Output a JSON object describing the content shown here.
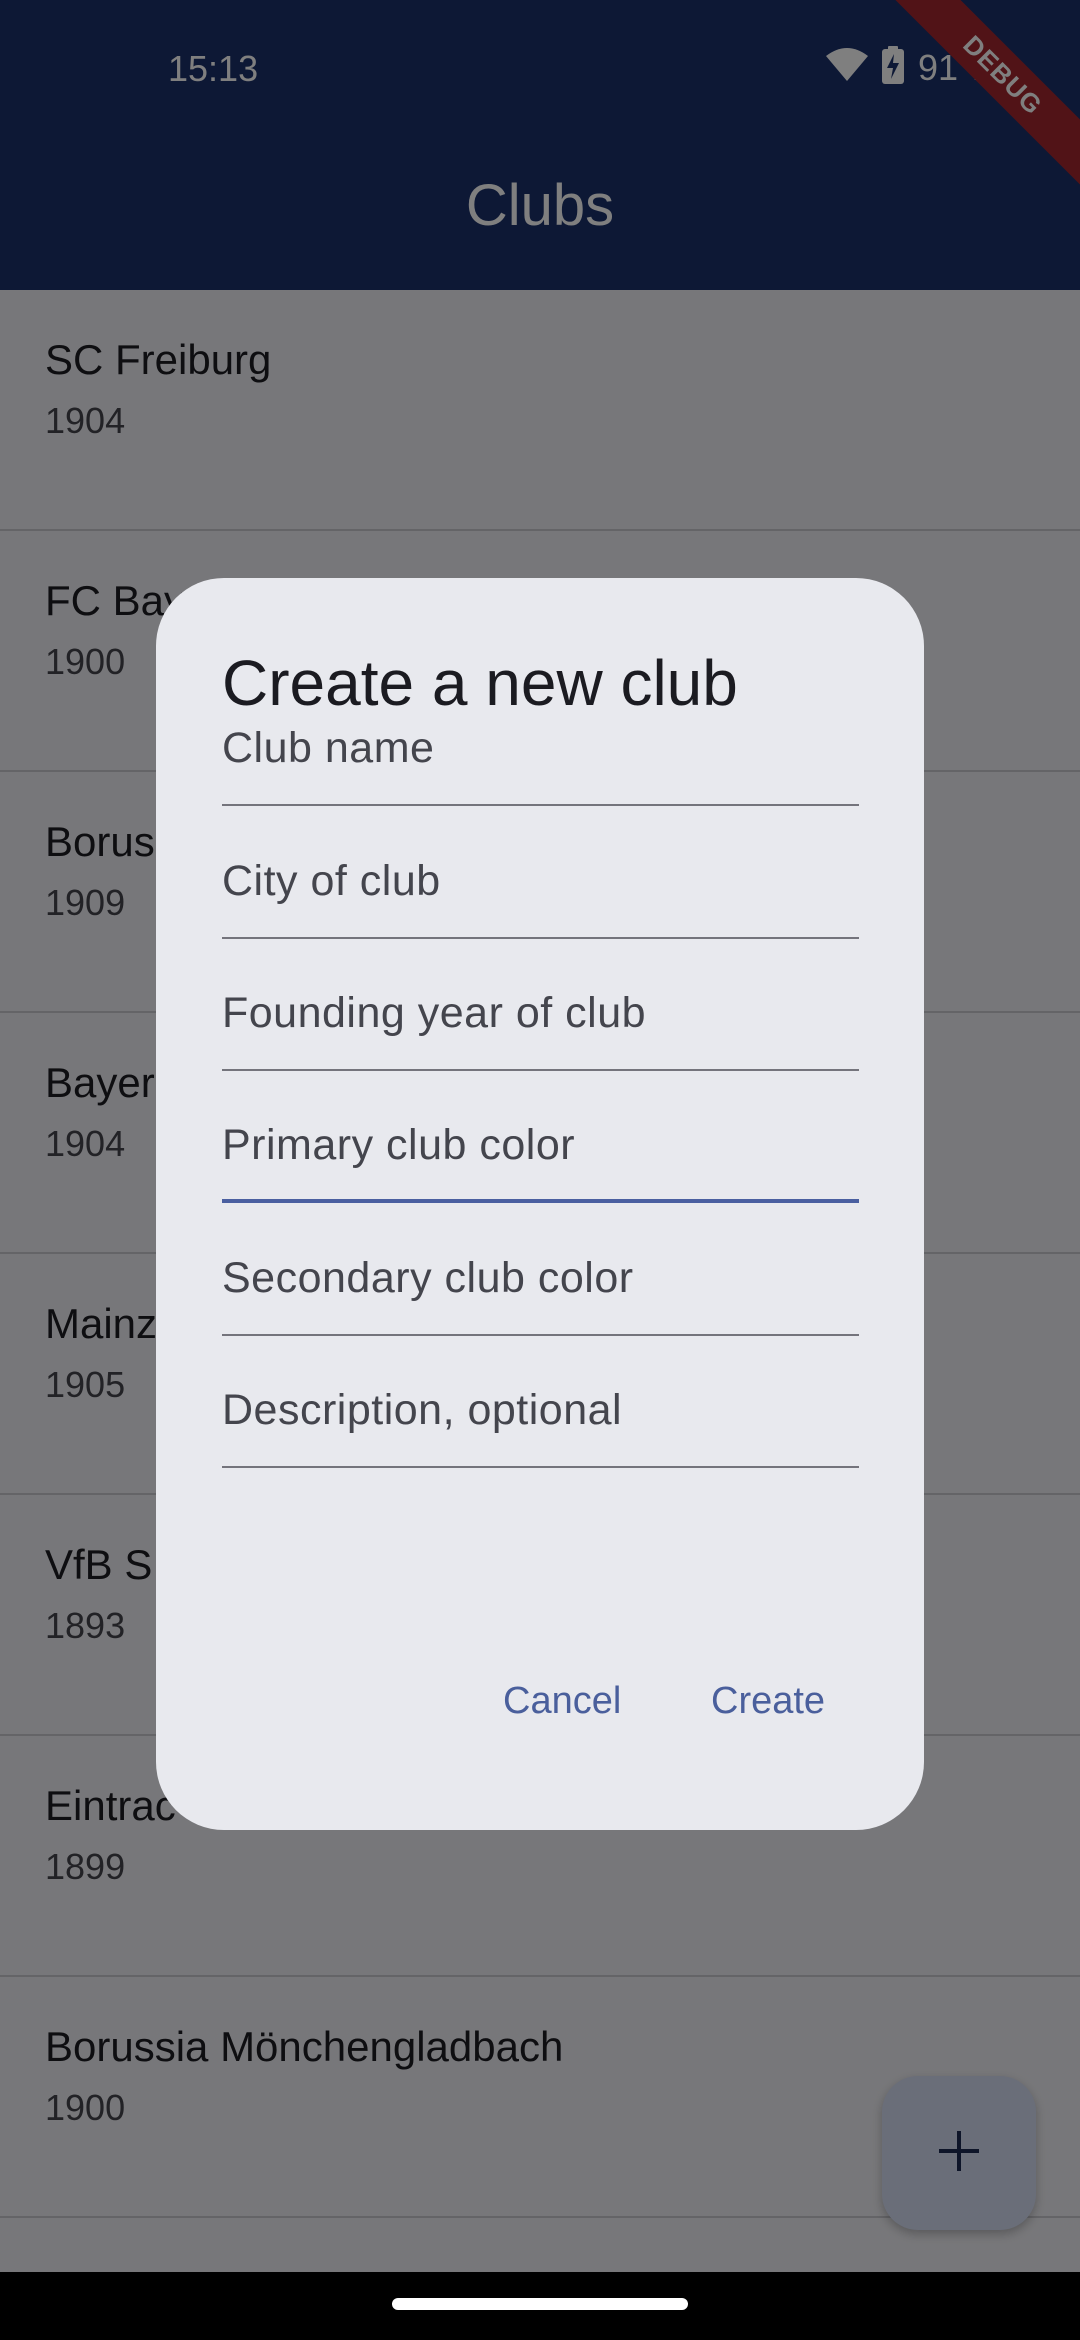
{
  "status_bar": {
    "time": "15:13",
    "battery": "91 %",
    "icons": [
      "wifi-icon",
      "battery-charging-icon"
    ]
  },
  "debug_banner": "DEBUG",
  "app_bar": {
    "title": "Clubs"
  },
  "clubs": [
    {
      "name": "SC Freiburg",
      "year": "1904"
    },
    {
      "name": "FC Bay",
      "year": "1900"
    },
    {
      "name": "Borus",
      "year": "1909"
    },
    {
      "name": "Bayer",
      "year": "1904"
    },
    {
      "name": "Mainz",
      "year": "1905"
    },
    {
      "name": "VfB S",
      "year": "1893"
    },
    {
      "name": "Eintrac",
      "year": "1899"
    },
    {
      "name": "Borussia Mönchengladbach",
      "year": "1900"
    }
  ],
  "dialog": {
    "title": "Create a new club",
    "fields": {
      "club_name": "Club name",
      "city": "City of club",
      "founding_year": "Founding year of club",
      "primary_color": "Primary club color",
      "secondary_color": "Secondary club color",
      "description": "Description, optional"
    },
    "cancel_label": "Cancel",
    "create_label": "Create"
  },
  "fab": {
    "icon": "plus-icon"
  },
  "colors": {
    "app_bar": "#1a306b",
    "dialog_bg": "#e8e9ee",
    "accent": "#4a5fa0",
    "fab_bg": "#d5dcf3",
    "debug": "#a3262e"
  }
}
